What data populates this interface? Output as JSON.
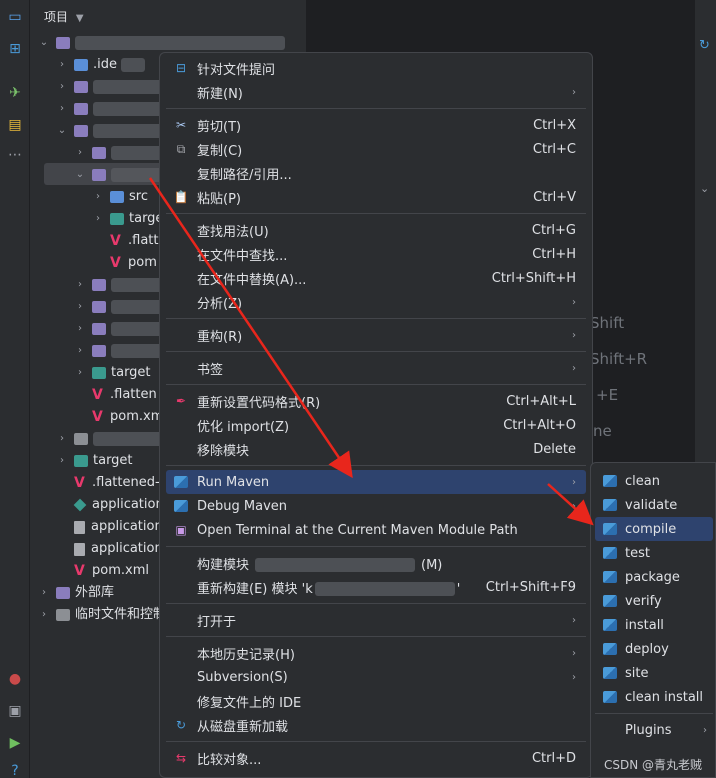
{
  "project_panel": {
    "title": "项目",
    "rows": {
      "ide": ".ide",
      "src": "src",
      "target_partial": "targe",
      "flatt_partial": ".flatt",
      "pom_partial": "pom",
      "target1": "target",
      "flatten_partial": ".flatten",
      "pomxm_partial": "pom.xm",
      "target2": "target",
      "flattened_partial": ".flattened-",
      "app1": "application",
      "app2": "application",
      "app3": "application",
      "pomxml": "pom.xml",
      "external": "外部库",
      "scratch": "临时文件和控制"
    }
  },
  "background_text": {
    "shift": "Shift",
    "shift_r": "Shift+R",
    "plus_e": "+E",
    "ne": "ne"
  },
  "context_menu": {
    "items": {
      "ask": "针对文件提问",
      "new": "新建(N)",
      "cut": "剪切(T)",
      "cut_sc": "Ctrl+X",
      "copy": "复制(C)",
      "copy_sc": "Ctrl+C",
      "copy_path": "复制路径/引用...",
      "paste": "粘贴(P)",
      "paste_sc": "Ctrl+V",
      "find_usages": "查找用法(U)",
      "find_usages_sc": "Ctrl+G",
      "find_in_files": "在文件中查找...",
      "find_in_files_sc": "Ctrl+H",
      "replace_in_files": "在文件中替换(A)...",
      "replace_in_files_sc": "Ctrl+Shift+H",
      "analyze": "分析(Z)",
      "refactor": "重构(R)",
      "bookmarks": "书签",
      "reformat": "重新设置代码格式(R)",
      "reformat_sc": "Ctrl+Alt+L",
      "optimize": "优化 import(Z)",
      "optimize_sc": "Ctrl+Alt+O",
      "remove_module": "移除模块",
      "remove_module_sc": "Delete",
      "run_maven": "Run Maven",
      "debug_maven": "Debug Maven",
      "open_terminal": "Open Terminal at the Current Maven Module Path",
      "build_module_prefix": "构建模块",
      "build_module_suffix": "(M)",
      "rebuild_prefix": "重新构建(E) 模块 'k",
      "rebuild_suffix": "'",
      "rebuild_sc": "Ctrl+Shift+F9",
      "open_in": "打开于",
      "local_history": "本地历史记录(H)",
      "subversion": "Subversion(S)",
      "fix_ide": "修复文件上的 IDE",
      "reload": "从磁盘重新加载",
      "compare": "比较对象...",
      "compare_sc": "Ctrl+D"
    }
  },
  "maven_submenu": {
    "items": [
      "clean",
      "validate",
      "compile",
      "test",
      "package",
      "verify",
      "install",
      "deploy",
      "site",
      "clean install"
    ],
    "plugins": "Plugins"
  },
  "watermark": "CSDN @青丸老贼",
  "colors": {
    "background": "#1e1f22",
    "panel": "#2b2d30",
    "highlight": "#2e436e",
    "arrow": "#e8261c",
    "text": "#dfe1e5"
  }
}
